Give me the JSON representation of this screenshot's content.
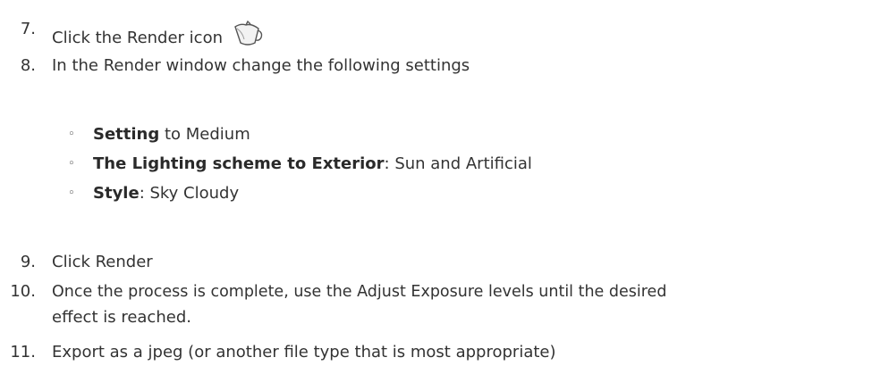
{
  "steps": [
    {
      "number": "7.",
      "text": "Click the Render icon",
      "icon": "teapot-render-icon"
    },
    {
      "number": "8.",
      "text": "In the Render window change the following settings"
    },
    {
      "number": "9.",
      "text": "Click Render"
    },
    {
      "number": "10.",
      "text_line1": "Once the process is complete, use the Adjust Exposure levels until the desired",
      "text_line2": "effect is reached."
    },
    {
      "number": "11.",
      "text": "Export as a jpeg (or another file type that is most appropriate)"
    }
  ],
  "settings": [
    {
      "label": "Setting",
      "value": " to Medium"
    },
    {
      "label": "The Lighting scheme to Exterior",
      "value": ": Sun and Artificial"
    },
    {
      "label": "Style",
      "value": ": Sky Cloudy"
    }
  ],
  "bullet_char": "◦"
}
